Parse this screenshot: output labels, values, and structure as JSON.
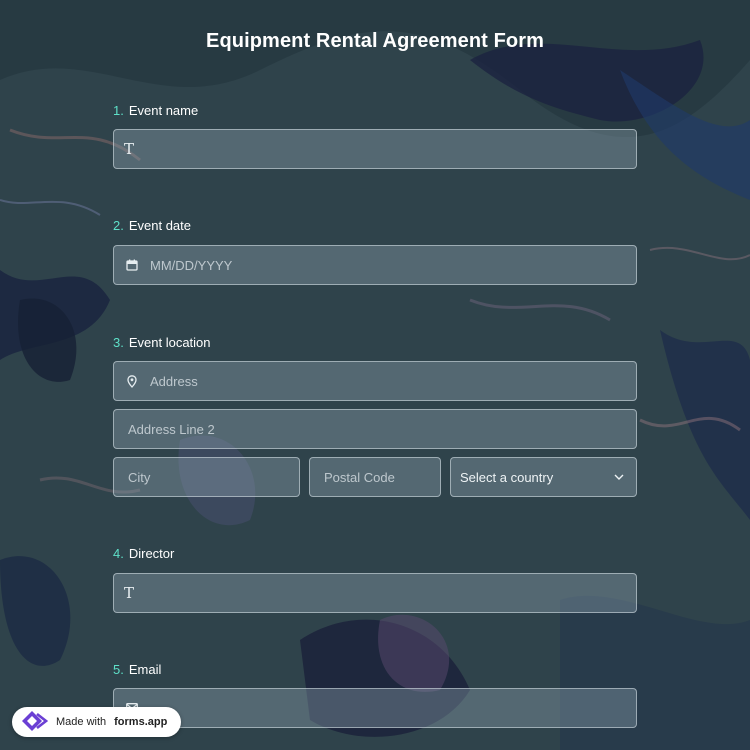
{
  "form": {
    "title": "Equipment Rental Agreement Form"
  },
  "questions": [
    {
      "number": "1.",
      "label": "Event name"
    },
    {
      "number": "2.",
      "label": "Event date",
      "placeholder": "MM/DD/YYYY"
    },
    {
      "number": "3.",
      "label": "Event location",
      "address_placeholder": "Address",
      "address2_placeholder": "Address Line 2",
      "city_placeholder": "City",
      "postal_placeholder": "Postal Code",
      "country_value": "Select a country"
    },
    {
      "number": "4.",
      "label": "Director"
    },
    {
      "number": "5.",
      "label": "Email"
    }
  ],
  "badge": {
    "prefix": "Made with",
    "brand": "forms.app"
  },
  "colors": {
    "accent_number": "#5ee0c8",
    "logo": "#6b3fd4"
  }
}
